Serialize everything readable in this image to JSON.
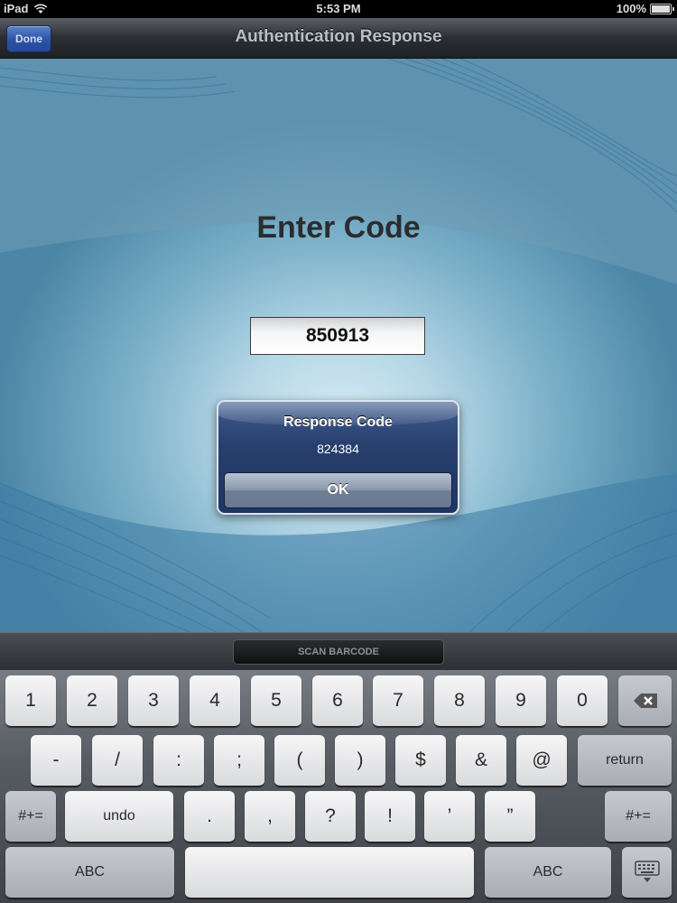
{
  "status_bar": {
    "device": "iPad",
    "time": "5:53 PM",
    "battery": "100%",
    "battery_level": 1.0
  },
  "nav_bar": {
    "title": "Authentication Response",
    "done_label": "Done"
  },
  "main": {
    "heading": "Enter Code",
    "code_value": "850913"
  },
  "alert": {
    "title": "Response Code",
    "message": "824384",
    "ok_label": "OK"
  },
  "accessory": {
    "scan_label": "SCAN BARCODE"
  },
  "keyboard": {
    "row1": [
      "1",
      "2",
      "3",
      "4",
      "5",
      "6",
      "7",
      "8",
      "9",
      "0"
    ],
    "row2": [
      "-",
      "/",
      ":",
      ";",
      "(",
      ")",
      "$",
      "&",
      "@"
    ],
    "return_label": "return",
    "symbols_label": "#+=",
    "undo_label": "undo",
    "row3": [
      ".",
      ",",
      "?",
      "!",
      "’",
      "”"
    ],
    "abc_label": "ABC"
  },
  "colors": {
    "alert_blue": "#283f6d",
    "done_blue": "#2e56a8",
    "background_teal": "#4b86a6"
  }
}
